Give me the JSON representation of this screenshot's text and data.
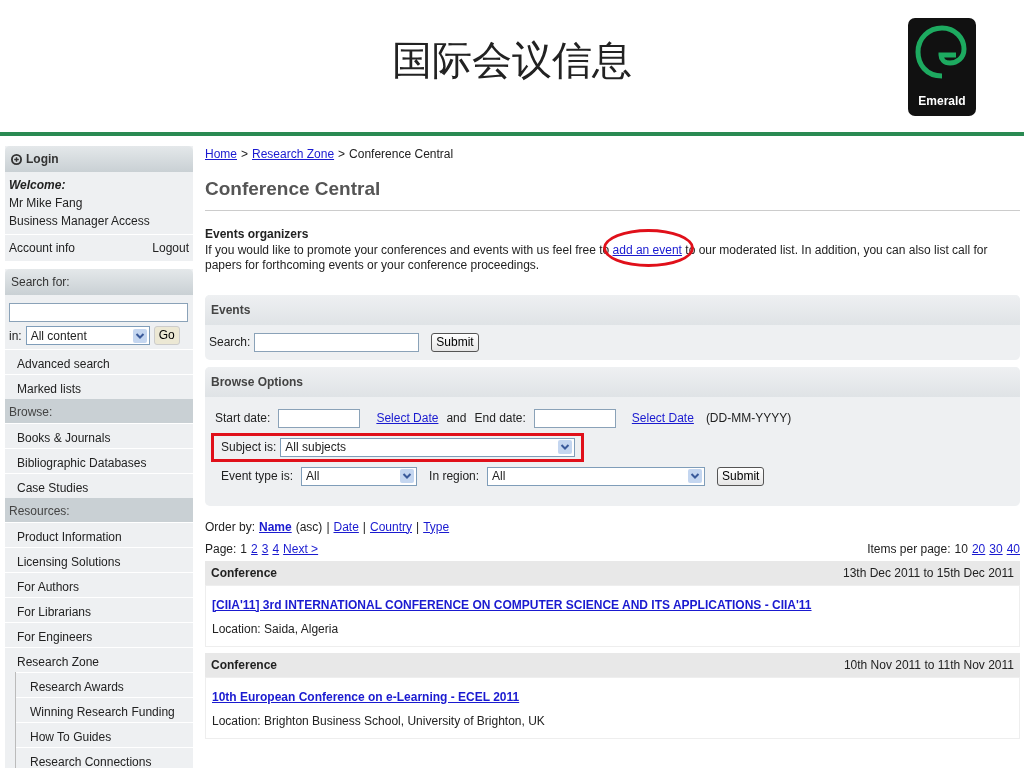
{
  "slide_title": "国际会议信息",
  "logo": {
    "text": "Emerald"
  },
  "sidebar": {
    "login": {
      "title": "Login",
      "welcome": "Welcome:",
      "name": "Mr Mike Fang",
      "access": "Business Manager Access",
      "account": "Account info",
      "logout": "Logout"
    },
    "search": {
      "title": "Search for:",
      "in_label": "in:",
      "scope": "All content",
      "go": "Go",
      "links": [
        "Advanced search",
        "Marked lists"
      ]
    },
    "sections": [
      {
        "title": "Browse:",
        "items": [
          {
            "label": "Books & Journals"
          },
          {
            "label": "Bibliographic Databases"
          },
          {
            "label": "Case Studies"
          }
        ]
      },
      {
        "title": "Resources:",
        "items": [
          {
            "label": "Product Information"
          },
          {
            "label": "Licensing Solutions"
          },
          {
            "label": "For Authors"
          },
          {
            "label": "For Librarians"
          },
          {
            "label": "For Engineers"
          },
          {
            "label": "Research Zone",
            "children": [
              {
                "label": "Research Awards"
              },
              {
                "label": "Winning Research Funding"
              },
              {
                "label": "How To Guides"
              },
              {
                "label": "Research Connections"
              }
            ]
          }
        ]
      }
    ]
  },
  "breadcrumb": {
    "separator": ">",
    "items": [
      {
        "label": "Home",
        "link": true
      },
      {
        "label": "Research Zone",
        "link": true
      },
      {
        "label": "Conference Central",
        "link": false
      }
    ]
  },
  "heading": "Conference Central",
  "organizers": {
    "title": "Events organizers",
    "text_before": "If you would like to promote your conferences and events with us feel free to",
    "link": "add an event",
    "link_highlighted": true,
    "text_after": "to our moderated list. In addition, you can also list call for papers for forthcoming events or your conference proceedings."
  },
  "events_panel": {
    "title": "Events",
    "search_label": "Search:",
    "submit": "Submit"
  },
  "browse_options": {
    "title": "Browse Options",
    "start_label": "Start date:",
    "select_date": "Select Date",
    "and": "and",
    "end_label": "End date:",
    "select_date_2": "Select Date",
    "format": "(DD-MM-YYYY)",
    "subject_label": "Subject is:",
    "subject_value": "All subjects",
    "subject_highlighted": true,
    "event_type_label": "Event type is:",
    "event_type_value": "All",
    "region_label": "In region:",
    "region_value": "All",
    "submit": "Submit"
  },
  "order": {
    "label": "Order by:",
    "separator": "|",
    "direction": "(asc)",
    "options": [
      {
        "label": "Name",
        "selected": true
      },
      {
        "label": "Date",
        "selected": false
      },
      {
        "label": "Country",
        "selected": false
      },
      {
        "label": "Type",
        "selected": false
      }
    ]
  },
  "paging": {
    "label": "Page:",
    "next": "Next >",
    "per_page_label": "Items per page:",
    "pages": [
      {
        "label": "1",
        "selected": true
      },
      {
        "label": "2",
        "selected": false
      },
      {
        "label": "3",
        "selected": false
      },
      {
        "label": "4",
        "selected": false
      }
    ],
    "per_page": [
      {
        "label": "10",
        "selected": true
      },
      {
        "label": "20",
        "selected": false
      },
      {
        "label": "30",
        "selected": false
      },
      {
        "label": "40",
        "selected": false
      }
    ]
  },
  "events": [
    {
      "type": "Conference",
      "dates": "13th Dec 2011 to 15th Dec 2011",
      "title": "[CIIA'11] 3rd INTERNATIONAL CONFERENCE ON COMPUTER SCIENCE AND ITS APPLICATIONS - CIIA'11",
      "location": "Location: Saida, Algeria"
    },
    {
      "type": "Conference",
      "dates": "10th Nov 2011 to 11th Nov 2011",
      "title": "10th European Conference on e-Learning - ECEL 2011",
      "location": "Location: Brighton Business School, University of Brighton, UK"
    }
  ]
}
